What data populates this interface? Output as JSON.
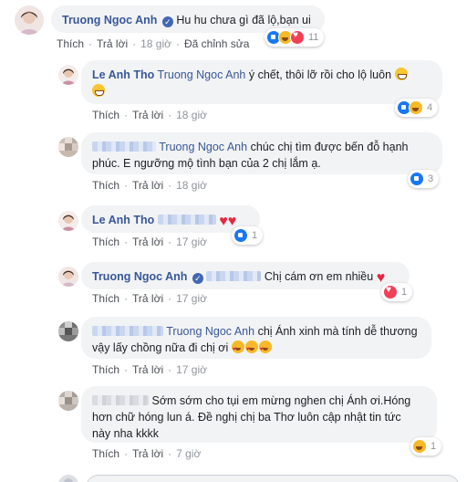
{
  "comments": [
    {
      "author": "Truong Ngoc Anh",
      "verified": true,
      "text": "Hu hu chưa gì đã lộ,bạn ui",
      "actions": {
        "like": "Thích",
        "reply": "Trả lời",
        "time": "18 giờ",
        "edited": "Đã chỉnh sửa"
      },
      "reactions": {
        "types": [
          "like",
          "haha",
          "love"
        ],
        "count": "11"
      }
    },
    {
      "author": "Le Anh Tho",
      "mention": "Truong Ngoc Anh",
      "text": "ý chết, thôi lỡ rồi cho lộ luôn",
      "actions": {
        "like": "Thích",
        "reply": "Trả lời",
        "time": "18 giờ"
      },
      "reactions": {
        "types": [
          "like",
          "haha"
        ],
        "count": "4"
      }
    },
    {
      "mention": "Truong Ngoc Anh",
      "text_line1": "chúc chị tìm được bến đỗ hạnh",
      "text_line2": "phúc. E ngưỡng mộ tình bạn của 2 chị lắm ạ.",
      "actions": {
        "like": "Thích",
        "reply": "Trả lời",
        "time": "18 giờ"
      },
      "reactions": {
        "types": [
          "like"
        ],
        "count": "3"
      }
    },
    {
      "author": "Le Anh Tho",
      "actions": {
        "like": "Thích",
        "reply": "Trả lời",
        "time": "17 giờ"
      },
      "reactions": {
        "types": [
          "like"
        ],
        "count": "1"
      }
    },
    {
      "author": "Truong Ngoc Anh",
      "text": "Chị cám ơn em nhiều",
      "actions": {
        "like": "Thích",
        "reply": "Trả lời",
        "time": "17 giờ"
      },
      "reactions": {
        "types": [
          "love"
        ],
        "count": "1"
      }
    },
    {
      "mention": "Truong Ngoc Anh",
      "text_line1": "chị Ánh xinh mà tính dễ thương",
      "text_line2": "vậy lấy chồng nữa đi chị ơi",
      "actions": {
        "like": "Thích",
        "reply": "Trả lời",
        "time": "17 giờ"
      }
    },
    {
      "text_line1": "Sớm sớm cho tụi em mừng nghen chị Ánh ơi.Hóng",
      "text_line2": "hơn chữ hóng lun á. Đề nghị chị ba Thơ luôn cập nhật tin tức",
      "text_line3": "này nha kkkk",
      "actions": {
        "like": "Thích",
        "reply": "Trả lời",
        "time": "7 giờ"
      },
      "reactions": {
        "types": [
          "haha"
        ],
        "count": "1"
      }
    }
  ],
  "colors": {
    "link": "#385898",
    "bubble": "#f2f3f5",
    "meta": "#90949c",
    "heart": "#e8263d"
  }
}
